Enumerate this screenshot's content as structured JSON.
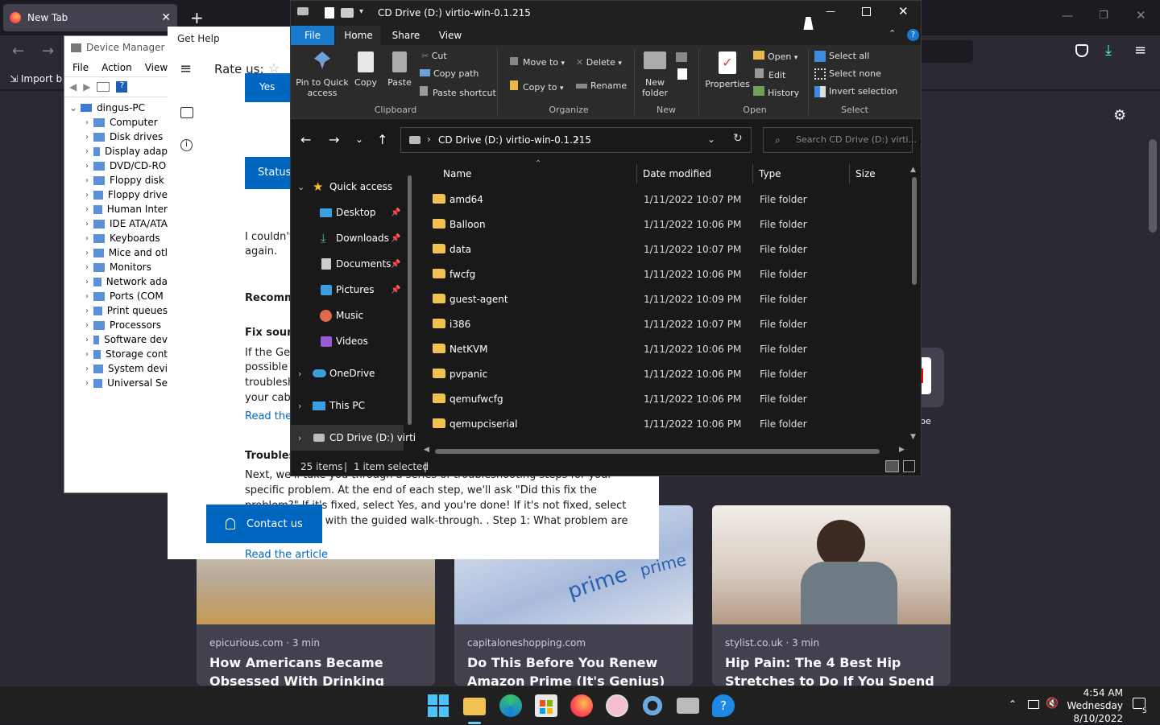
{
  "firefox": {
    "tab_title": "New Tab",
    "bookmark_import": "Import b",
    "cards": [
      {
        "source": "epicurious.com · 3 min",
        "title": "How Americans Became Obsessed With Drinking Apple Cider",
        "color": "#a58e6e"
      },
      {
        "source": "capitaloneshopping.com",
        "title": "Do This Before You Renew Amazon Prime (It's Genius)",
        "color": "#c8d2e6"
      },
      {
        "source": "stylist.co.uk · 3 min",
        "title": "Hip Pain: The 4 Best Hip Stretches to Do If You Spend All Day Sitting",
        "color": "#e9e4de"
      }
    ],
    "partial_label": "be"
  },
  "device_manager": {
    "title": "Device Manager",
    "menu": [
      "File",
      "Action",
      "View"
    ],
    "root": "dingus-PC",
    "items": [
      "Computer",
      "Disk drives",
      "Display adap",
      "DVD/CD-RO",
      "Floppy disk",
      "Floppy drive",
      "Human Inter",
      "IDE ATA/ATA",
      "Keyboards",
      "Mice and otl",
      "Monitors",
      "Network ada",
      "Ports (COM",
      "Print queues",
      "Processors",
      "Software dev",
      "Storage cont",
      "System devi",
      "Universal Se"
    ]
  },
  "get_help": {
    "title": "Get Help",
    "rate_us": "Rate us:",
    "yes_button": "Yes",
    "status_button": "Status",
    "couldnt_text": "I couldn't",
    "again_text": "again.",
    "recommended": "Recomm",
    "fix_sound": "Fix sound",
    "fix_text": [
      "If the Get",
      "possible",
      "troublesh",
      "your cabl"
    ],
    "read_the": "Read the",
    "troubleshoot_heading": "Troubles",
    "long_text_1": "Next, we'll take you through a series of troubleshooting steps for your",
    "long_text_2": "specific problem. At the end of each step, we'll ask \"Did this fix the",
    "long_text_3": "problem?\" If it's fixed, select Yes, and you're done! If it's not fixed, select",
    "long_text_4": "No to continue with the guided walk-through. . Step 1: What problem are",
    "read_article": "Read the article",
    "contact_us": "Contact us"
  },
  "explorer": {
    "title": "CD Drive (D:) virtio-win-0.1.215",
    "ribbon_tabs": [
      "File",
      "Home",
      "Share",
      "View"
    ],
    "active_tab": "Home",
    "clipboard": {
      "pin": "Pin to Quick access",
      "copy": "Copy",
      "paste": "Paste",
      "cut": "Cut",
      "copy_path": "Copy path",
      "paste_shortcut": "Paste shortcut",
      "group": "Clipboard"
    },
    "organize": {
      "move_to": "Move to",
      "copy_to": "Copy to",
      "delete": "Delete",
      "rename": "Rename",
      "group": "Organize"
    },
    "new": {
      "new_folder": "New folder",
      "group": "New"
    },
    "open": {
      "properties": "Properties",
      "open": "Open",
      "edit": "Edit",
      "history": "History",
      "group": "Open"
    },
    "select": {
      "select_all": "Select all",
      "select_none": "Select none",
      "invert": "Invert selection",
      "group": "Select"
    },
    "address": "CD Drive (D:) virtio-win-0.1.215",
    "search_placeholder": "Search CD Drive (D:) virti...",
    "nav": {
      "quick_access": "Quick access",
      "pinned": [
        "Desktop",
        "Downloads",
        "Documents",
        "Pictures"
      ],
      "music": "Music",
      "videos": "Videos",
      "onedrive": "OneDrive",
      "thispc": "This PC",
      "cddrive": "CD Drive (D:) virti"
    },
    "columns": [
      "Name",
      "Date modified",
      "Type",
      "Size"
    ],
    "files": [
      {
        "name": "amd64",
        "date": "1/11/2022 10:07 PM",
        "type": "File folder"
      },
      {
        "name": "Balloon",
        "date": "1/11/2022 10:06 PM",
        "type": "File folder"
      },
      {
        "name": "data",
        "date": "1/11/2022 10:07 PM",
        "type": "File folder"
      },
      {
        "name": "fwcfg",
        "date": "1/11/2022 10:06 PM",
        "type": "File folder"
      },
      {
        "name": "guest-agent",
        "date": "1/11/2022 10:09 PM",
        "type": "File folder"
      },
      {
        "name": "i386",
        "date": "1/11/2022 10:07 PM",
        "type": "File folder"
      },
      {
        "name": "NetKVM",
        "date": "1/11/2022 10:06 PM",
        "type": "File folder"
      },
      {
        "name": "pvpanic",
        "date": "1/11/2022 10:06 PM",
        "type": "File folder"
      },
      {
        "name": "qemufwcfg",
        "date": "1/11/2022 10:06 PM",
        "type": "File folder"
      },
      {
        "name": "qemupciserial",
        "date": "1/11/2022 10:06 PM",
        "type": "File folder"
      }
    ],
    "status_items": "25 items",
    "status_selected": "1 item selected"
  },
  "taskbar": {
    "time": "4:54 AM",
    "day": "Wednesday",
    "date": "8/10/2022",
    "notif_count": "5"
  }
}
